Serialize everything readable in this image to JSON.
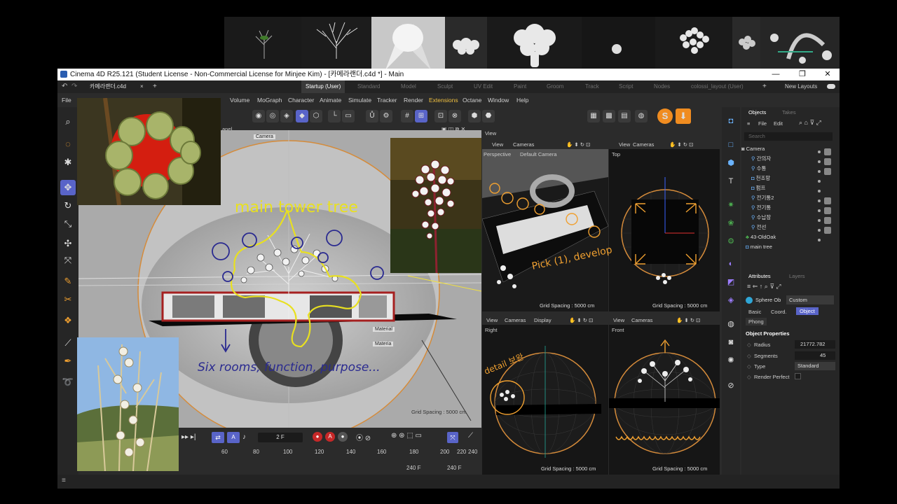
{
  "window": {
    "title": "Cinema 4D R25.121 (Student License - Non-Commercial License for Minjee Kim) - [카메라랜더.c4d *] - Main",
    "minimize": "—",
    "maximize": "❐",
    "close": "✕"
  },
  "tabs": {
    "file_tab": "카메라랜더.c4d",
    "close": "×",
    "add": "+",
    "layouts": [
      "Startup (User)",
      "Standard",
      "Model",
      "Sculpt",
      "UV Edit",
      "Paint",
      "Groom",
      "Track",
      "Script",
      "Nodes",
      "colossi_layout (User)"
    ],
    "new_layouts": "New Layouts"
  },
  "menu": [
    "File",
    "Volume",
    "MoGraph",
    "Character",
    "Animate",
    "Simulate",
    "Tracker",
    "Render",
    "Extensions",
    "Octane",
    "Window",
    "Help"
  ],
  "viewport_main": {
    "panel": "anel",
    "camera_label": "Camera",
    "material_1": "Material",
    "material_2": "Materia",
    "grid": "Grid Spacing : 5000 cm"
  },
  "viewports": {
    "view_title": "View",
    "perspective": {
      "menu": [
        "View",
        "Cameras"
      ],
      "label": "Perspective",
      "camera": "Default Camera",
      "grid": "Grid Spacing : 5000 cm"
    },
    "top": {
      "menu": [
        "View",
        "Cameras"
      ],
      "label": "Top",
      "grid": "Grid Spacing : 5000 cm"
    },
    "right": {
      "menu": [
        "View",
        "Cameras",
        "Display"
      ],
      "label": "Right",
      "grid": "Grid Spacing : 5000 cm"
    },
    "front": {
      "menu": [
        "View",
        "Cameras"
      ],
      "label": "Front",
      "grid": "Grid Spacing : 5000 cm"
    }
  },
  "timeline": {
    "frame": "2 F",
    "ticks": [
      "60",
      "80",
      "100",
      "120",
      "140",
      "160",
      "180",
      "200",
      "220",
      "240"
    ],
    "end_a": "240 F",
    "end_b": "240 F"
  },
  "objects_panel": {
    "tab_objects": "Objects",
    "tab_takes": "Takes",
    "menu": [
      "File",
      "Edit"
    ],
    "search": "Search",
    "items": [
      "Camera",
      "간의자",
      "수통",
      "천조망",
      "펌프",
      "전기통2",
      "전기통",
      "수납장",
      "전선",
      "43-OldOak",
      "main tree"
    ]
  },
  "attributes_panel": {
    "tab_attributes": "Attributes",
    "tab_layers": "Layers",
    "object_name": "Sphere Ob",
    "mode": "Custom",
    "tabs": [
      "Basic",
      "Coord.",
      "Object"
    ],
    "phong": "Phong",
    "section": "Object Properties",
    "props": [
      {
        "label": "Radius",
        "value": "21772.782"
      },
      {
        "label": "Segments",
        "value": "45"
      },
      {
        "label": "Type",
        "value": "Standard"
      },
      {
        "label": "Render Perfect",
        "value": ""
      }
    ]
  },
  "annotations": {
    "main_tower_tree": "main tower tree",
    "six_rooms": "Six rooms, function, purpose...",
    "pick_develop": "Pick (1), develop",
    "detail": "detail 보완"
  },
  "colors": {
    "accent": "#5964c8",
    "orange": "#f0a030",
    "yellow_ink": "#e8e020",
    "blue_ink": "#2a2a90",
    "panel_bg": "#2b2b2b"
  }
}
